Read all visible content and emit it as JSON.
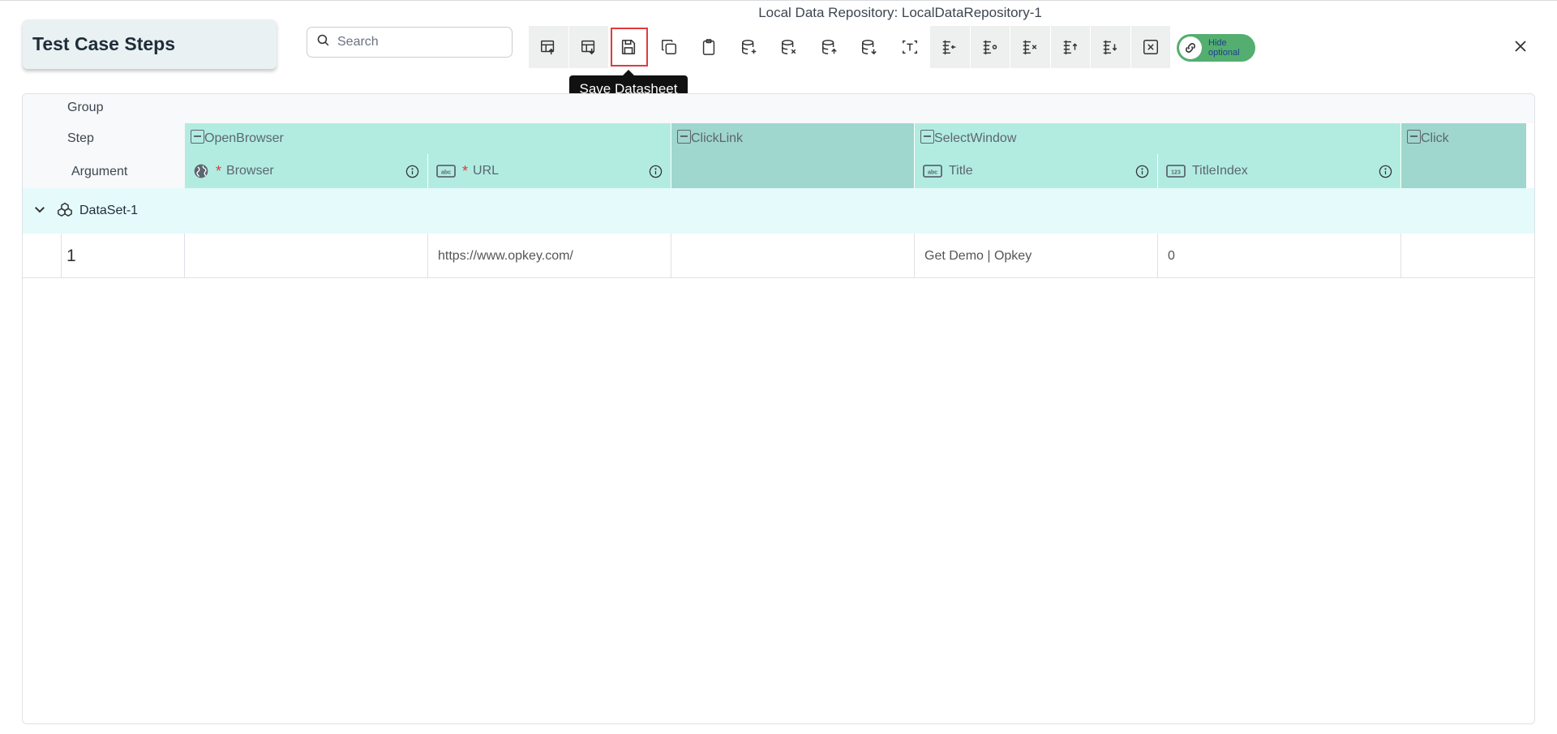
{
  "window": {
    "title": "Local Data Repository: LocalDataRepository-1"
  },
  "panel": {
    "title": "Test Case Steps"
  },
  "search": {
    "placeholder": "Search",
    "value": ""
  },
  "toolbar": {
    "buttons": [
      {
        "name": "import-icon"
      },
      {
        "name": "export-icon"
      },
      {
        "name": "save-icon",
        "tooltip": "Save Datasheet"
      },
      {
        "name": "copy-icon"
      },
      {
        "name": "paste-icon"
      },
      {
        "name": "add-dataset-icon"
      },
      {
        "name": "delete-dataset-icon"
      },
      {
        "name": "move-dataset-up-icon"
      },
      {
        "name": "move-dataset-down-icon"
      },
      {
        "name": "text-icon"
      },
      {
        "name": "insert-row-before-icon"
      },
      {
        "name": "insert-row-after-icon"
      },
      {
        "name": "delete-row-icon"
      },
      {
        "name": "move-row-up-icon"
      },
      {
        "name": "move-row-down-icon"
      },
      {
        "name": "clear-icon"
      }
    ]
  },
  "tooltip": {
    "text": "Save Datasheet"
  },
  "toggle": {
    "label_line1": "Hide",
    "label_line2": "optional",
    "on": true
  },
  "grid": {
    "row_labels": {
      "group": "Group",
      "step": "Step",
      "argument": "Argument"
    },
    "steps": [
      {
        "name": "OpenBrowser",
        "color": "#b2ece0"
      },
      {
        "name": "ClickLink",
        "color": "#9fd6cd"
      },
      {
        "name": "SelectWindow",
        "color": "#b2ece0"
      },
      {
        "name": "Click",
        "color": "#9fd6cd"
      }
    ],
    "arguments": [
      {
        "name": "Browser",
        "required": true,
        "icon": "globe-icon"
      },
      {
        "name": "URL",
        "required": true,
        "icon": "abc-icon"
      },
      {
        "name": "",
        "required": false,
        "icon": ""
      },
      {
        "name": "Title",
        "required": false,
        "icon": "abc-icon"
      },
      {
        "name": "TitleIndex",
        "required": false,
        "icon": "number-icon"
      },
      {
        "name": "",
        "required": false,
        "icon": ""
      }
    ],
    "dataset": {
      "name": "DataSet-1"
    },
    "rows": [
      {
        "index": "1",
        "cells": [
          "",
          "https://www.opkey.com/",
          "",
          "Get Demo | Opkey",
          "0",
          ""
        ]
      }
    ]
  },
  "colors": {
    "accent_red": "#e0363b",
    "toggle_green": "#54ae6f",
    "dataset_bg": "#e5fafb"
  }
}
